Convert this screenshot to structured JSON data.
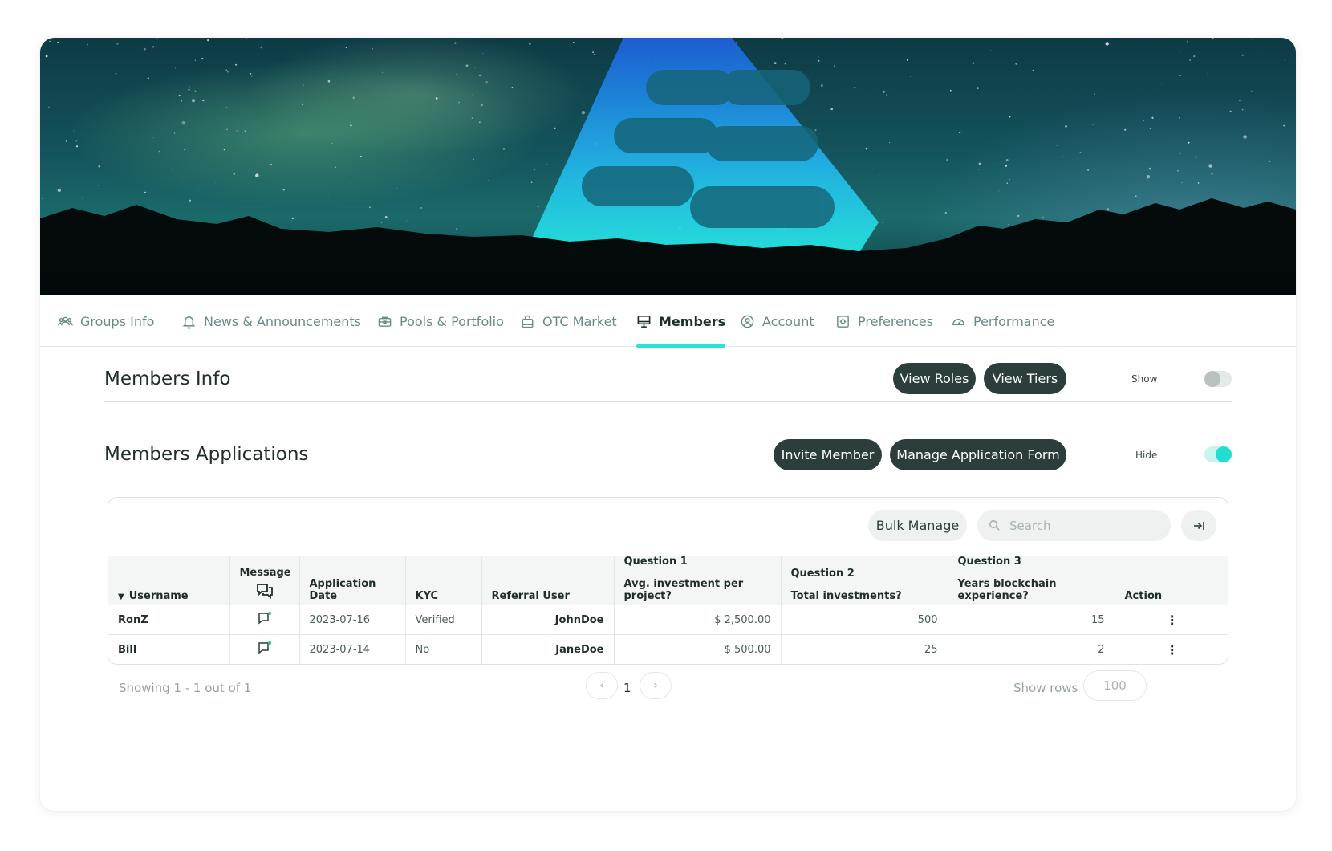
{
  "tabs": [
    {
      "label": "Groups Info",
      "icon": "people-icon"
    },
    {
      "label": "News & Announcements",
      "icon": "bell-icon"
    },
    {
      "label": "Pools & Portfolio",
      "icon": "briefcase-icon"
    },
    {
      "label": "OTC Market",
      "icon": "shopping-bag-icon"
    },
    {
      "label": "Members",
      "icon": "monitor-icon",
      "active": true
    },
    {
      "label": "Account",
      "icon": "user-circle-icon"
    },
    {
      "label": "Preferences",
      "icon": "settings-square-icon"
    },
    {
      "label": "Performance",
      "icon": "gauge-icon"
    }
  ],
  "members_info": {
    "title": "Members Info",
    "view_roles": "View Roles",
    "view_tiers": "View Tiers",
    "toggle_label": "Show",
    "toggle_on": false
  },
  "members_applications": {
    "title": "Members Applications",
    "invite_member": "Invite Member",
    "manage_form": "Manage Application Form",
    "toggle_label": "Hide",
    "toggle_on": true
  },
  "table": {
    "bulk_manage": "Bulk Manage",
    "search_placeholder": "Search",
    "columns": {
      "username": "Username",
      "message": "Message",
      "application_date": "Application Date",
      "kyc": "KYC",
      "referral_user": "Referral User",
      "q1_title": "Question 1",
      "q1_text": "Avg. investment per project?",
      "q2_title": "Question 2",
      "q2_text": "Total investments?",
      "q3_title": "Question 3",
      "q3_text": "Years blockchain experience?",
      "action": "Action"
    },
    "rows": [
      {
        "username": "RonZ",
        "date": "2023-07-16",
        "kyc": "Verified",
        "referral": "JohnDoe",
        "q1": "$ 2,500.00",
        "q2": "500",
        "q3": "15"
      },
      {
        "username": "Bill",
        "date": "2023-07-14",
        "kyc": "No",
        "referral": "JaneDoe",
        "q1": "$ 500.00",
        "q2": "25",
        "q3": "2"
      }
    ]
  },
  "footer": {
    "showing": "Showing 1 - 1 out of 1",
    "page": "1",
    "show_rows_label": "Show rows",
    "rows_value": "100"
  },
  "colors": {
    "accent": "#2de3d4",
    "dark_button": "#2b3e3b"
  }
}
